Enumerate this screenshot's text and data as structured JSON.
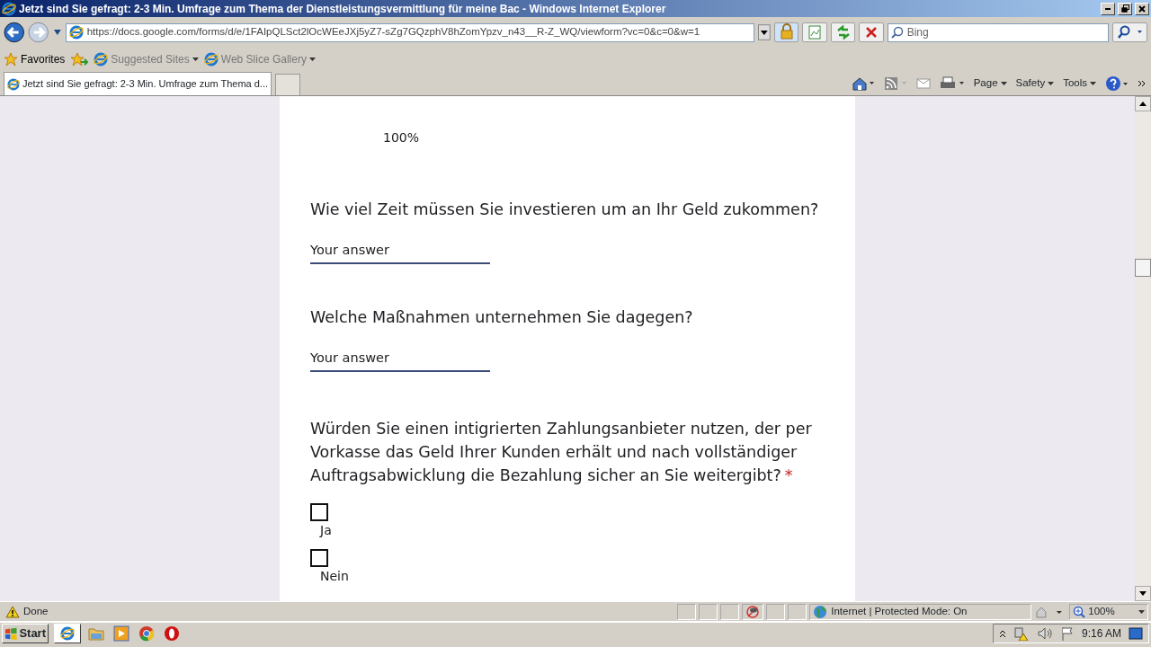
{
  "window": {
    "title": "Jetzt sind Sie gefragt: 2-3 Min. Umfrage zum Thema der Dienstleistungsvermittlung für meine Bac - Windows Internet Explorer"
  },
  "address_bar": {
    "url": "https://docs.google.com/forms/d/e/1FAIpQLSct2lOcWEeJXj5yZ7-sZg7GQzphV8hZomYpzv_n43__R-Z_WQ/viewform?vc=0&c=0&w=1"
  },
  "search": {
    "placeholder": "Bing"
  },
  "favorites_bar": {
    "label": "Favorites",
    "items": [
      "Suggested Sites",
      "Web Slice Gallery"
    ]
  },
  "tabs": [
    {
      "label": "Jetzt sind Sie gefragt: 2-3 Min. Umfrage zum Thema d...",
      "selected": true
    }
  ],
  "command_bar": [
    "Page",
    "Safety",
    "Tools"
  ],
  "form": {
    "progress": "100%",
    "questions": [
      {
        "kind": "text",
        "title": "Wie viel Zeit müssen Sie investieren um an Ihr Geld zukommen?",
        "placeholder": "Your answer"
      },
      {
        "kind": "text",
        "title": "Welche Maßnahmen unternehmen Sie dagegen?",
        "placeholder": "Your answer"
      },
      {
        "kind": "checkbox",
        "title": "Würden Sie einen intigrierten Zahlungsanbieter nutzen, der per Vorkasse das Geld Ihrer Kunden erhält und nach vollständiger Auftragsabwicklung die Bezahlung sicher an Sie weitergibt?",
        "required_mark": "*",
        "options": [
          {
            "label": "Ja",
            "checked": false
          },
          {
            "label": "Nein",
            "checked": false
          }
        ]
      }
    ]
  },
  "status_bar": {
    "text": "Done",
    "zone": "Internet | Protected Mode: On",
    "zoom": "100%"
  },
  "taskbar": {
    "start": "Start",
    "clock": "9:16 AM"
  }
}
